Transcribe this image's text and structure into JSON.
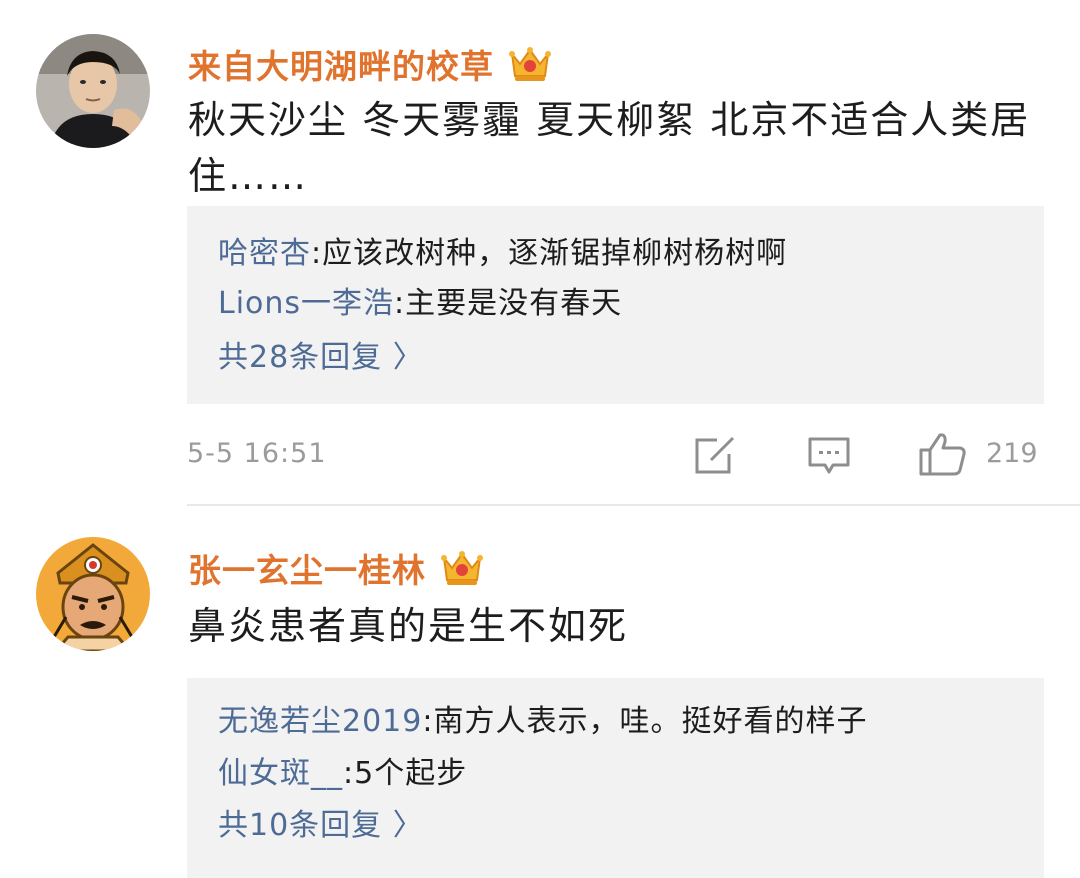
{
  "comments": [
    {
      "username": "来自大明湖畔的校草",
      "content": "秋天沙尘 冬天雾霾 夏天柳絮 北京不适合人类居住……",
      "replies": [
        {
          "user": "哈密杏",
          "sep": ":",
          "text": "应该改树种，逐渐锯掉柳树杨树啊"
        },
        {
          "user": "Lions一李浩",
          "sep": ":",
          "text": "主要是没有春天"
        }
      ],
      "more_replies": "共28条回复 〉",
      "time": "5-5 16:51",
      "likes": "219"
    },
    {
      "username": "张一玄尘一桂林",
      "content": "鼻炎患者真的是生不如死",
      "replies": [
        {
          "user": "无逸若尘2019",
          "sep": ":",
          "text": "南方人表示，哇。挺好看的样子"
        },
        {
          "user": "仙女斑__",
          "sep": ":",
          "text": "5个起步"
        }
      ],
      "more_replies": "共10条回复 〉"
    }
  ],
  "icons": {
    "crown": "crown-icon",
    "edit": "edit-icon",
    "comment": "comment-icon",
    "like": "thumbs-up-icon"
  },
  "colors": {
    "username": "#e0742e",
    "reply_user": "#4e6b96",
    "reply_bg": "#f2f2f2",
    "meta": "#9b9b9b"
  }
}
